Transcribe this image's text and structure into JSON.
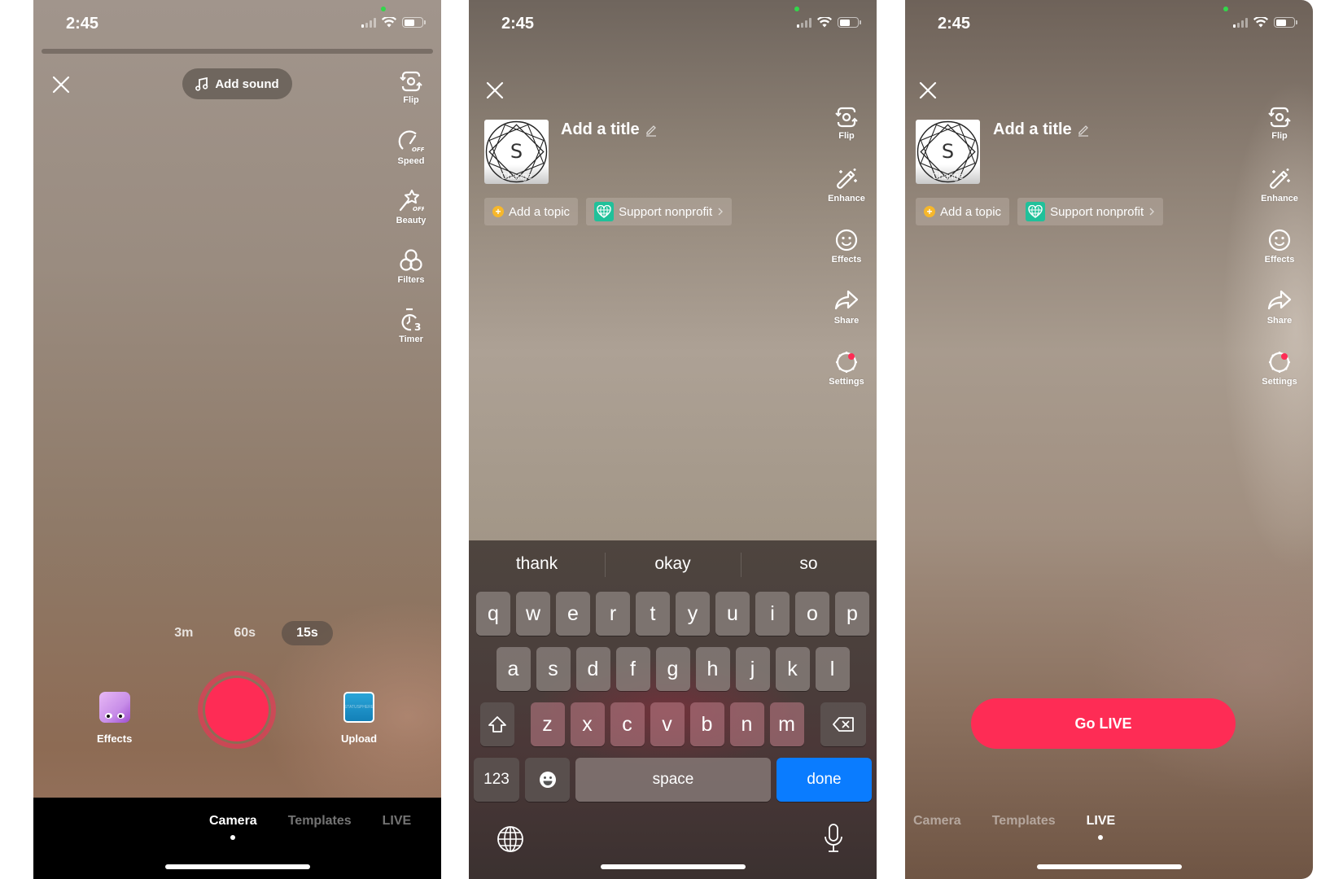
{
  "status_bar": {
    "time": "2:45"
  },
  "colors": {
    "accent_red": "#fe2c55",
    "done_blue": "#0a7cff",
    "nonprofit_green": "#20c19a",
    "topic_yellow": "#f6b72b",
    "camera_dot_green": "#32d74b"
  },
  "screen1": {
    "add_sound_label": "Add sound",
    "rail": [
      {
        "icon": "flip-camera-icon",
        "label": "Flip"
      },
      {
        "icon": "speed-off-icon",
        "label": "Speed"
      },
      {
        "icon": "beauty-off-icon",
        "label": "Beauty"
      },
      {
        "icon": "filters-icon",
        "label": "Filters"
      },
      {
        "icon": "timer-3s-icon",
        "label": "Timer"
      }
    ],
    "durations": [
      {
        "label": "3m",
        "active": false
      },
      {
        "label": "60s",
        "active": false
      },
      {
        "label": "15s",
        "active": true
      }
    ],
    "effects_label": "Effects",
    "upload_label": "Upload",
    "upload_thumb_text": "STATUSPHERE",
    "mode_tabs": [
      {
        "label": "Camera",
        "active": true
      },
      {
        "label": "Templates",
        "active": false
      },
      {
        "label": "LIVE",
        "active": false
      }
    ]
  },
  "screen2": {
    "cover_letter": "S",
    "cover_change_label": "Change",
    "title_placeholder": "Add a title",
    "topic_chip": "Add a topic",
    "nonprofit_chip": "Support nonprofit",
    "rail": [
      {
        "icon": "flip-camera-icon",
        "label": "Flip"
      },
      {
        "icon": "enhance-wand-icon",
        "label": "Enhance"
      },
      {
        "icon": "effects-smiley-icon",
        "label": "Effects"
      },
      {
        "icon": "share-arrow-icon",
        "label": "Share"
      },
      {
        "icon": "settings-gear-icon",
        "label": "Settings",
        "badge": true
      }
    ],
    "keyboard": {
      "suggestions": [
        "thank",
        "okay",
        "so"
      ],
      "row1": [
        "q",
        "w",
        "e",
        "r",
        "t",
        "y",
        "u",
        "i",
        "o",
        "p"
      ],
      "row2": [
        "a",
        "s",
        "d",
        "f",
        "g",
        "h",
        "j",
        "k",
        "l"
      ],
      "row3": [
        "z",
        "x",
        "c",
        "v",
        "b",
        "n",
        "m"
      ],
      "numbers_key": "123",
      "space_key": "space",
      "done_key": "done"
    }
  },
  "screen3": {
    "cover_letter": "S",
    "cover_change_label": "Change",
    "title_placeholder": "Add a title",
    "topic_chip": "Add a topic",
    "nonprofit_chip": "Support nonprofit",
    "rail": [
      {
        "icon": "flip-camera-icon",
        "label": "Flip"
      },
      {
        "icon": "enhance-wand-icon",
        "label": "Enhance"
      },
      {
        "icon": "effects-smiley-icon",
        "label": "Effects"
      },
      {
        "icon": "share-arrow-icon",
        "label": "Share"
      },
      {
        "icon": "settings-gear-icon",
        "label": "Settings",
        "badge": true
      }
    ],
    "go_live_label": "Go LIVE",
    "mode_tabs": [
      {
        "label": "Camera",
        "active": false
      },
      {
        "label": "Templates",
        "active": false
      },
      {
        "label": "LIVE",
        "active": true
      }
    ]
  }
}
